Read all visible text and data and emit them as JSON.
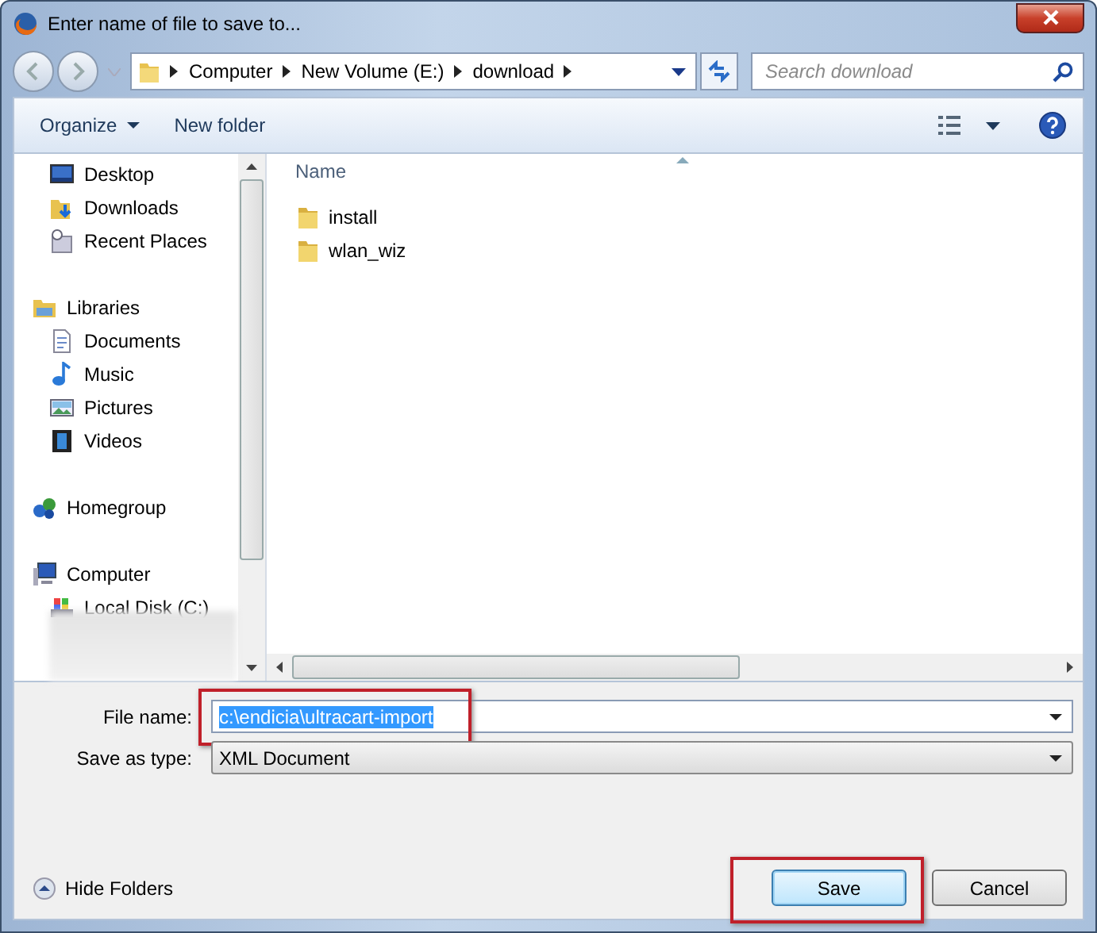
{
  "window": {
    "title": "Enter name of file to save to..."
  },
  "breadcrumb": [
    "Computer",
    "New Volume (E:)",
    "download"
  ],
  "search": {
    "placeholder": "Search download"
  },
  "toolbar": {
    "organize": "Organize",
    "new_folder": "New folder"
  },
  "nav": [
    {
      "children": [
        {
          "label": "Desktop",
          "kind": "desktop"
        },
        {
          "label": "Downloads",
          "kind": "downloads"
        },
        {
          "label": "Recent Places",
          "kind": "recent"
        }
      ]
    },
    {
      "label": "Libraries",
      "kind": "libraries",
      "children": [
        {
          "label": "Documents",
          "kind": "document"
        },
        {
          "label": "Music",
          "kind": "music"
        },
        {
          "label": "Pictures",
          "kind": "pictures"
        },
        {
          "label": "Videos",
          "kind": "videos"
        }
      ]
    },
    {
      "label": "Homegroup",
      "kind": "homegroup"
    },
    {
      "label": "Computer",
      "kind": "computer",
      "children": [
        {
          "label": "Local Disk (C:)",
          "kind": "disk"
        }
      ]
    }
  ],
  "columns": [
    "Name"
  ],
  "files": [
    {
      "name": "install"
    },
    {
      "name": "wlan_wiz"
    }
  ],
  "file_name": {
    "label": "File name:",
    "value": "c:\\endicia\\ultracart-import",
    "selected": true
  },
  "save_as_type": {
    "label": "Save as type:",
    "value": "XML Document"
  },
  "hide_folders": "Hide Folders",
  "buttons": [
    {
      "label": "Save",
      "default": true
    },
    {
      "label": "Cancel",
      "default": false
    }
  ]
}
